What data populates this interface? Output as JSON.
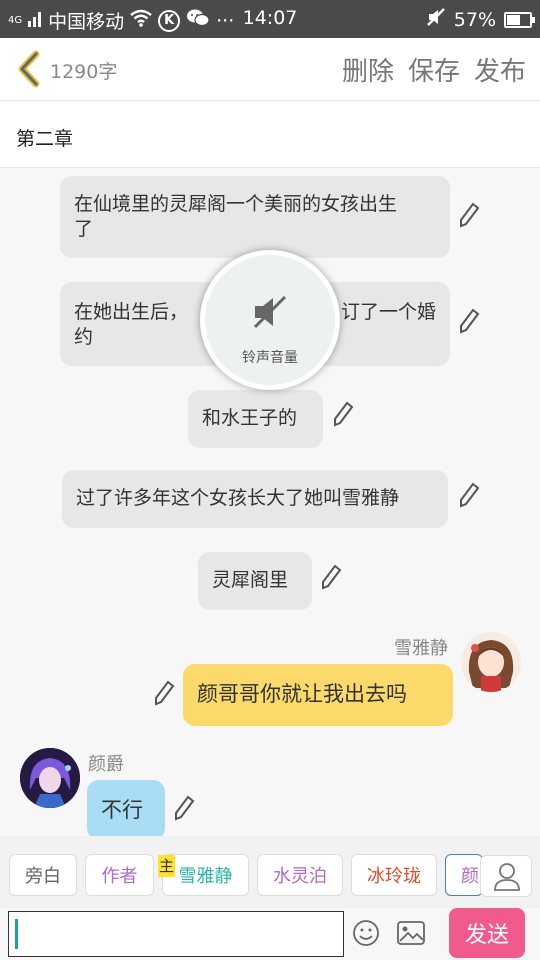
{
  "status_bar": {
    "network": "4G",
    "carrier": "中国移动",
    "more": "···",
    "time": "14:07",
    "battery": "57%",
    "battery_level": 0.57
  },
  "header": {
    "word_count": "1290字",
    "delete_label": "删除",
    "save_label": "保存",
    "publish_label": "发布"
  },
  "chapter": {
    "title": "第二章"
  },
  "messages": [
    {
      "text_line1": "在仙境里的灵犀阁一个美丽的女孩出生",
      "text_line2": "了"
    },
    {
      "text_line1": "在她出生后，",
      "text_line1_right": "订了一个婚",
      "text_line2": "约"
    },
    {
      "text": "和水王子的"
    },
    {
      "text": "过了许多年这个女孩长大了她叫雪雅静"
    },
    {
      "text": "灵犀阁里"
    },
    {
      "sender": "雪雅静",
      "text": "颜哥哥你就让我出去吗"
    },
    {
      "sender": "颜爵",
      "text": "不行"
    }
  ],
  "volume_overlay": {
    "label": "铃声音量",
    "icon": "speaker-muted-icon"
  },
  "roles": [
    {
      "label": "旁白",
      "color": "#666666"
    },
    {
      "label": "作者",
      "color": "#b06ac8"
    },
    {
      "label": "雪雅静",
      "color": "#2bb5a8",
      "badge": "主"
    },
    {
      "label": "水灵泊",
      "color": "#b06ac8"
    },
    {
      "label": "冰玲珑",
      "color": "#e04a2a"
    },
    {
      "label": "颜",
      "color": "#b06ac8"
    }
  ],
  "input": {
    "value": "",
    "send_label": "发送"
  },
  "colors": {
    "accent_send": "#f05a8c",
    "own_bubble": "#fbd96a",
    "other_bubble": "#a9dcf5",
    "narration_bubble": "#e7e7e7"
  }
}
